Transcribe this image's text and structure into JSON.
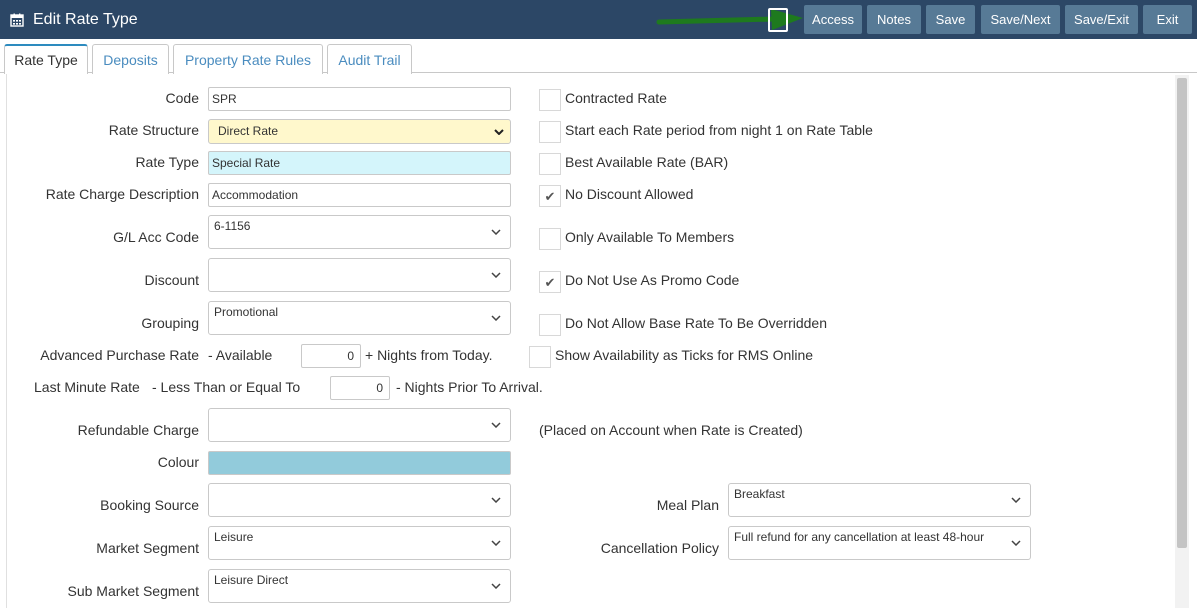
{
  "header": {
    "title": "Edit Rate Type",
    "icon": "calendar-icon",
    "buttons": {
      "access": "Access",
      "notes": "Notes",
      "save": "Save",
      "save_next": "Save/Next",
      "save_exit": "Save/Exit",
      "exit": "Exit"
    },
    "annotation_color": "#1e7a1e"
  },
  "tabs": [
    "Rate Type",
    "Deposits",
    "Property Rate Rules",
    "Audit Trail"
  ],
  "form": {
    "code": {
      "label": "Code",
      "value": "SPR"
    },
    "rate_structure": {
      "label": "Rate Structure",
      "value": "Direct Rate"
    },
    "rate_type": {
      "label": "Rate Type",
      "value": "Special Rate"
    },
    "rate_charge_description": {
      "label": "Rate Charge Description",
      "value": "Accommodation"
    },
    "gl_acc_code": {
      "label": "G/L Acc Code",
      "value": "6-1156"
    },
    "discount": {
      "label": "Discount",
      "value": ""
    },
    "grouping": {
      "label": "Grouping",
      "value": "Promotional"
    },
    "advanced_purchase": {
      "label": "Advanced Purchase Rate",
      "sub": "- Available",
      "value": "0",
      "suffix": "+ Nights from Today."
    },
    "last_minute": {
      "label": "Last Minute Rate",
      "sub": "- Less Than or Equal To",
      "value": "0",
      "suffix": "- Nights Prior To Arrival."
    },
    "refundable_charge": {
      "label": "Refundable Charge",
      "value": "",
      "note": "(Placed on Account when Rate is Created)"
    },
    "colour": {
      "label": "Colour",
      "value": "#92cbdb"
    },
    "booking_source": {
      "label": "Booking Source",
      "value": ""
    },
    "market_segment": {
      "label": "Market Segment",
      "value": "Leisure"
    },
    "sub_market_segment": {
      "label": "Sub Market Segment",
      "value": "Leisure Direct"
    },
    "meal_plan": {
      "label": "Meal Plan",
      "value": "Breakfast"
    },
    "cancellation_policy": {
      "label": "Cancellation Policy",
      "value": "Full refund for any cancellation at least 48-hour"
    }
  },
  "checkboxes": [
    {
      "label": "Contracted Rate",
      "checked": false
    },
    {
      "label": "Start each Rate period from night 1 on Rate Table",
      "checked": false
    },
    {
      "label": "Best Available Rate (BAR)",
      "checked": false
    },
    {
      "label": "No Discount Allowed",
      "checked": true
    },
    {
      "label": "Only Available To Members",
      "checked": false
    },
    {
      "label": "Do Not Use As Promo Code",
      "checked": true
    },
    {
      "label": "Do Not Allow Base Rate To Be Overridden",
      "checked": false
    },
    {
      "label": "Show Availability as Ticks for RMS Online",
      "checked": false
    }
  ],
  "colors": {
    "header_bg": "#2c4766",
    "button_bg": "#577a96",
    "rate_structure_bg": "#fff8cc",
    "rate_type_bg": "#d4f5fb",
    "tab_link": "#4a8cbf"
  }
}
